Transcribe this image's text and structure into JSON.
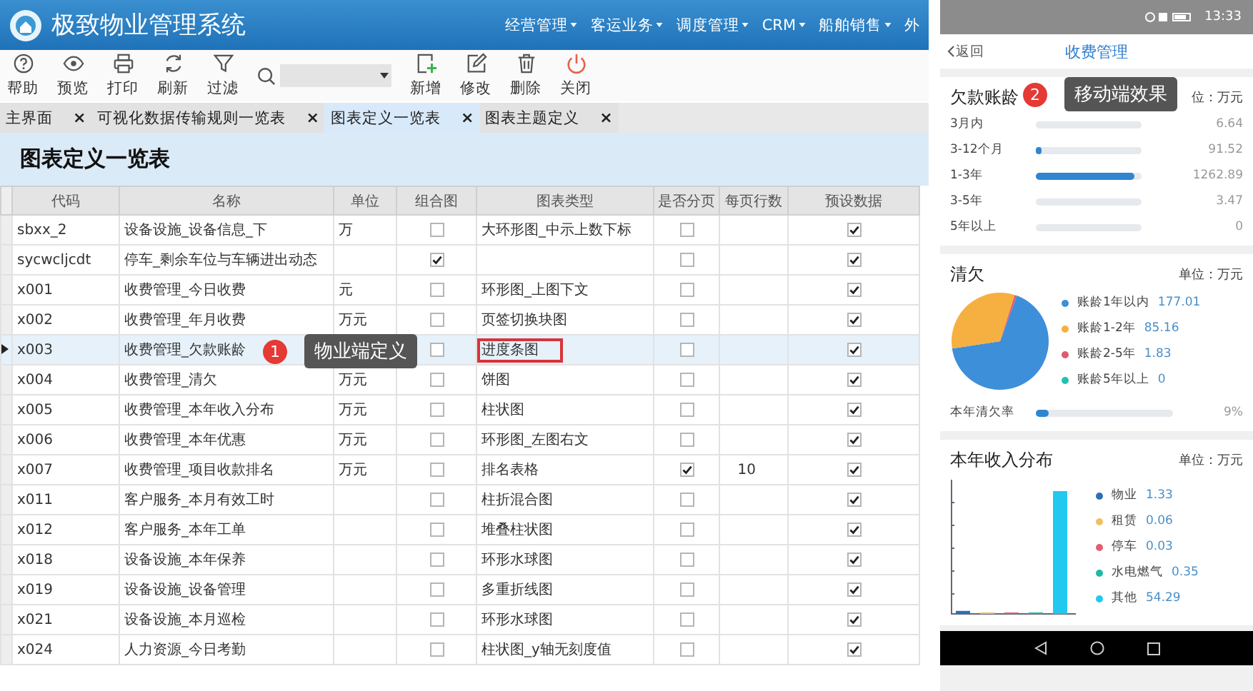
{
  "app": {
    "title": "极致物业管理系统",
    "menu": [
      {
        "label": "经营管理"
      },
      {
        "label": "客运业务"
      },
      {
        "label": "调度管理"
      },
      {
        "label": "CRM"
      },
      {
        "label": "船舶销售"
      },
      {
        "label": "外"
      }
    ]
  },
  "toolbar": [
    {
      "kind": "help",
      "label": "帮助"
    },
    {
      "kind": "preview",
      "label": "预览"
    },
    {
      "kind": "print",
      "label": "打印"
    },
    {
      "kind": "refresh",
      "label": "刷新"
    },
    {
      "kind": "filter",
      "label": "过滤"
    },
    {
      "kind": "search"
    },
    {
      "kind": "add",
      "label": "新增"
    },
    {
      "kind": "edit",
      "label": "修改"
    },
    {
      "kind": "delete",
      "label": "删除"
    },
    {
      "kind": "close",
      "label": "关闭"
    }
  ],
  "tabs": [
    {
      "label": "主界面",
      "close": "×",
      "selected": false
    },
    {
      "label": "可视化数据传输规则一览表",
      "close": "×",
      "selected": false
    },
    {
      "label": "图表定义一览表",
      "close": "×",
      "selected": true
    },
    {
      "label": "图表主题定义",
      "close": "×",
      "selected": false
    }
  ],
  "page_title": "图表定义一览表",
  "table": {
    "columns": [
      "代码",
      "名称",
      "单位",
      "组合图",
      "图表类型",
      "是否分页",
      "每页行数",
      "预设数据"
    ],
    "rows": [
      {
        "selected": false,
        "code": "sbxx_2",
        "name": "设备设施_设备信息_下",
        "unit": "万",
        "combined": false,
        "chart_type": "大环形图_中示上数下标",
        "paged": false,
        "preset": true
      },
      {
        "selected": false,
        "code": "sycwcljcdt",
        "name": "停车_剩余车位与车辆进出动态",
        "combined": true,
        "paged": false,
        "preset": true
      },
      {
        "selected": false,
        "code": "x001",
        "name": "收费管理_今日收费",
        "unit": "元",
        "combined": false,
        "chart_type": "环形图_上图下文",
        "paged": false,
        "preset": true
      },
      {
        "selected": false,
        "code": "x002",
        "name": "收费管理_年月收费",
        "unit": "万元",
        "combined": false,
        "chart_type": "页签切换块图",
        "paged": false,
        "preset": true
      },
      {
        "selected": true,
        "code": "x003",
        "name": "收费管理_欠款账龄",
        "combined": false,
        "chart_type": "进度条图",
        "highlighted": true,
        "paged": false,
        "preset": true
      },
      {
        "selected": false,
        "code": "x004",
        "name": "收费管理_清欠",
        "unit": "万元",
        "combined": false,
        "chart_type": "饼图",
        "paged": false,
        "preset": true
      },
      {
        "selected": false,
        "code": "x005",
        "name": "收费管理_本年收入分布",
        "unit": "万元",
        "combined": false,
        "chart_type": "柱状图",
        "paged": false,
        "preset": true
      },
      {
        "selected": false,
        "code": "x006",
        "name": "收费管理_本年优惠",
        "unit": "万元",
        "combined": false,
        "chart_type": "环形图_左图右文",
        "paged": false,
        "preset": true
      },
      {
        "selected": false,
        "code": "x007",
        "name": "收费管理_项目收款排名",
        "unit": "万元",
        "combined": false,
        "chart_type": "排名表格",
        "paged": true,
        "per_page": "10",
        "preset": true
      },
      {
        "selected": false,
        "code": "x011",
        "name": "客户服务_本月有效工时",
        "combined": false,
        "chart_type": "柱折混合图",
        "paged": false,
        "preset": true
      },
      {
        "selected": false,
        "code": "x012",
        "name": "客户服务_本年工单",
        "combined": false,
        "chart_type": "堆叠柱状图",
        "paged": false,
        "preset": true
      },
      {
        "selected": false,
        "code": "x018",
        "name": "设备设施_本年保养",
        "combined": false,
        "chart_type": "环形水球图",
        "paged": false,
        "preset": true
      },
      {
        "selected": false,
        "code": "x019",
        "name": "设备设施_设备管理",
        "combined": false,
        "chart_type": "多重折线图",
        "paged": false,
        "preset": true
      },
      {
        "selected": false,
        "code": "x021",
        "name": "设备设施_本月巡检",
        "combined": false,
        "chart_type": "环形水球图",
        "paged": false,
        "preset": true
      },
      {
        "selected": false,
        "code": "x024",
        "name": "人力资源_今日考勤",
        "combined": false,
        "chart_type": "柱状图_y轴无刻度值",
        "paged": false,
        "preset": true
      }
    ]
  },
  "annotations": [
    {
      "number": "1",
      "text": "物业端定义"
    },
    {
      "number": "2",
      "text": "移动端效果"
    }
  ],
  "mobile": {
    "time": "13:33",
    "back": "返回",
    "title": "收费管理",
    "aging": {
      "title": "欠款账龄",
      "unit": "位：万元",
      "rows": [
        {
          "label": "3月内",
          "level": 0,
          "value": "6.64"
        },
        {
          "label": "3-12个月",
          "level": 0.06,
          "value": "91.52"
        },
        {
          "label": "1-3年",
          "level": 0.93,
          "value": "1262.89"
        },
        {
          "label": "3-5年",
          "level": 0,
          "value": "3.47"
        },
        {
          "label": "5年以上",
          "level": 0,
          "value": "0"
        }
      ]
    },
    "clearance": {
      "title": "清欠",
      "unit": "单位：万元",
      "legend": [
        {
          "label": "账龄1年以内",
          "value": "177.01",
          "color": "#3d8fd9"
        },
        {
          "label": "账龄1-2年",
          "value": "85.16",
          "color": "#f5b041"
        },
        {
          "label": "账龄2-5年",
          "value": "1.83",
          "color": "#e05a6b"
        },
        {
          "label": "账龄5年以上",
          "value": "0",
          "color": "#1fc2b0"
        }
      ],
      "rate_label": "本年清欠率",
      "rate": {
        "level": 0.09
      },
      "rate_value": "9%"
    },
    "income": {
      "title": "本年收入分布",
      "unit": "单位：万元",
      "legend": [
        {
          "label": "物业",
          "value": "1.33",
          "color": "#2f6fb0"
        },
        {
          "label": "租赁",
          "value": "0.06",
          "color": "#f0c060"
        },
        {
          "label": "停车",
          "value": "0.03",
          "color": "#e06070"
        },
        {
          "label": "水电燃气",
          "value": "0.35",
          "color": "#20b8a8"
        },
        {
          "label": "其他",
          "value": "54.29",
          "color": "#22c8ee"
        }
      ]
    }
  }
}
